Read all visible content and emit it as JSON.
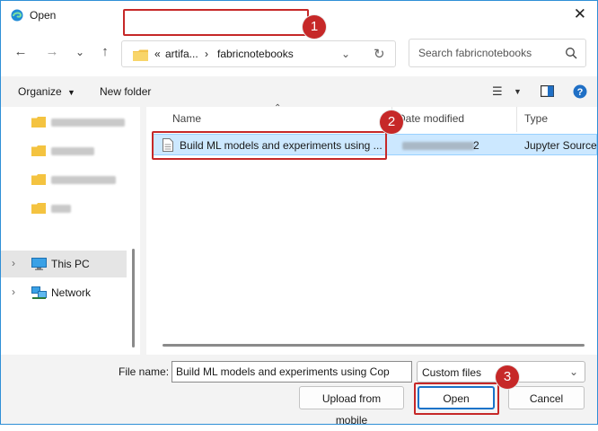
{
  "window": {
    "title": "Open"
  },
  "address": {
    "overflow": "«",
    "crumb1": "artifa...",
    "separator": "›",
    "crumb2": "fabricnotebooks"
  },
  "search": {
    "placeholder": "Search fabricnotebooks"
  },
  "toolbar": {
    "organize_label": "Organize",
    "new_folder_label": "New folder"
  },
  "navpane": {
    "items": [
      {
        "label": "This PC",
        "icon": "pc-icon"
      },
      {
        "label": "Network",
        "icon": "network-icon"
      }
    ]
  },
  "filelist": {
    "columns": {
      "name": "Name",
      "date_modified": "Date modified",
      "type": "Type"
    },
    "rows": [
      {
        "name": "Build ML models and experiments using ...",
        "date_suffix": "2",
        "type": "Jupyter Source"
      }
    ]
  },
  "footer": {
    "file_name_label": "File name:",
    "file_name_value": "Build ML models and experiments using Cop",
    "filter_value": "Custom files",
    "upload_label": "Upload from mobile",
    "open_label": "Open",
    "cancel_label": "Cancel"
  },
  "annotations": [
    "1",
    "2",
    "3"
  ],
  "colors": {
    "accent": "#1a73c9",
    "highlight": "#c62828",
    "selection": "#cce8ff"
  }
}
